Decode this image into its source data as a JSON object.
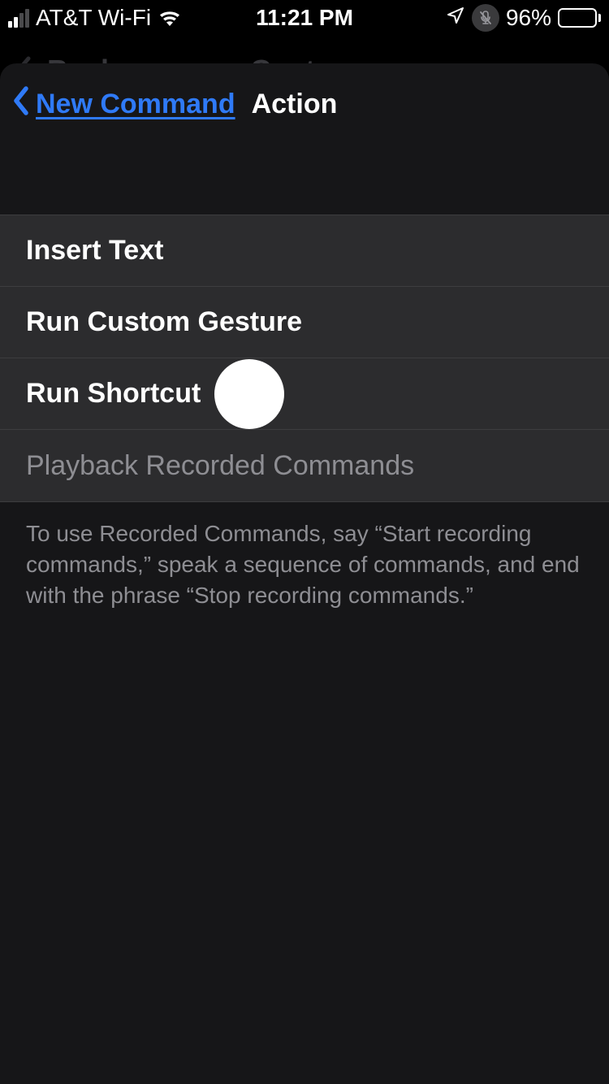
{
  "status": {
    "carrier": "AT&T Wi-Fi",
    "time": "11:21 PM",
    "battery_pct": "96%"
  },
  "under_nav": {
    "back_label": "Back",
    "title": "Custom"
  },
  "sheet": {
    "back_label": "New Command",
    "title": "Action"
  },
  "options": {
    "insert_text": "Insert Text",
    "run_gesture": "Run Custom Gesture",
    "run_shortcut": "Run Shortcut",
    "playback": "Playback Recorded Commands"
  },
  "footer_note": "To use Recorded Commands, say “Start recording commands,” speak a sequence of commands, and end with the phrase “Stop recording commands.”"
}
